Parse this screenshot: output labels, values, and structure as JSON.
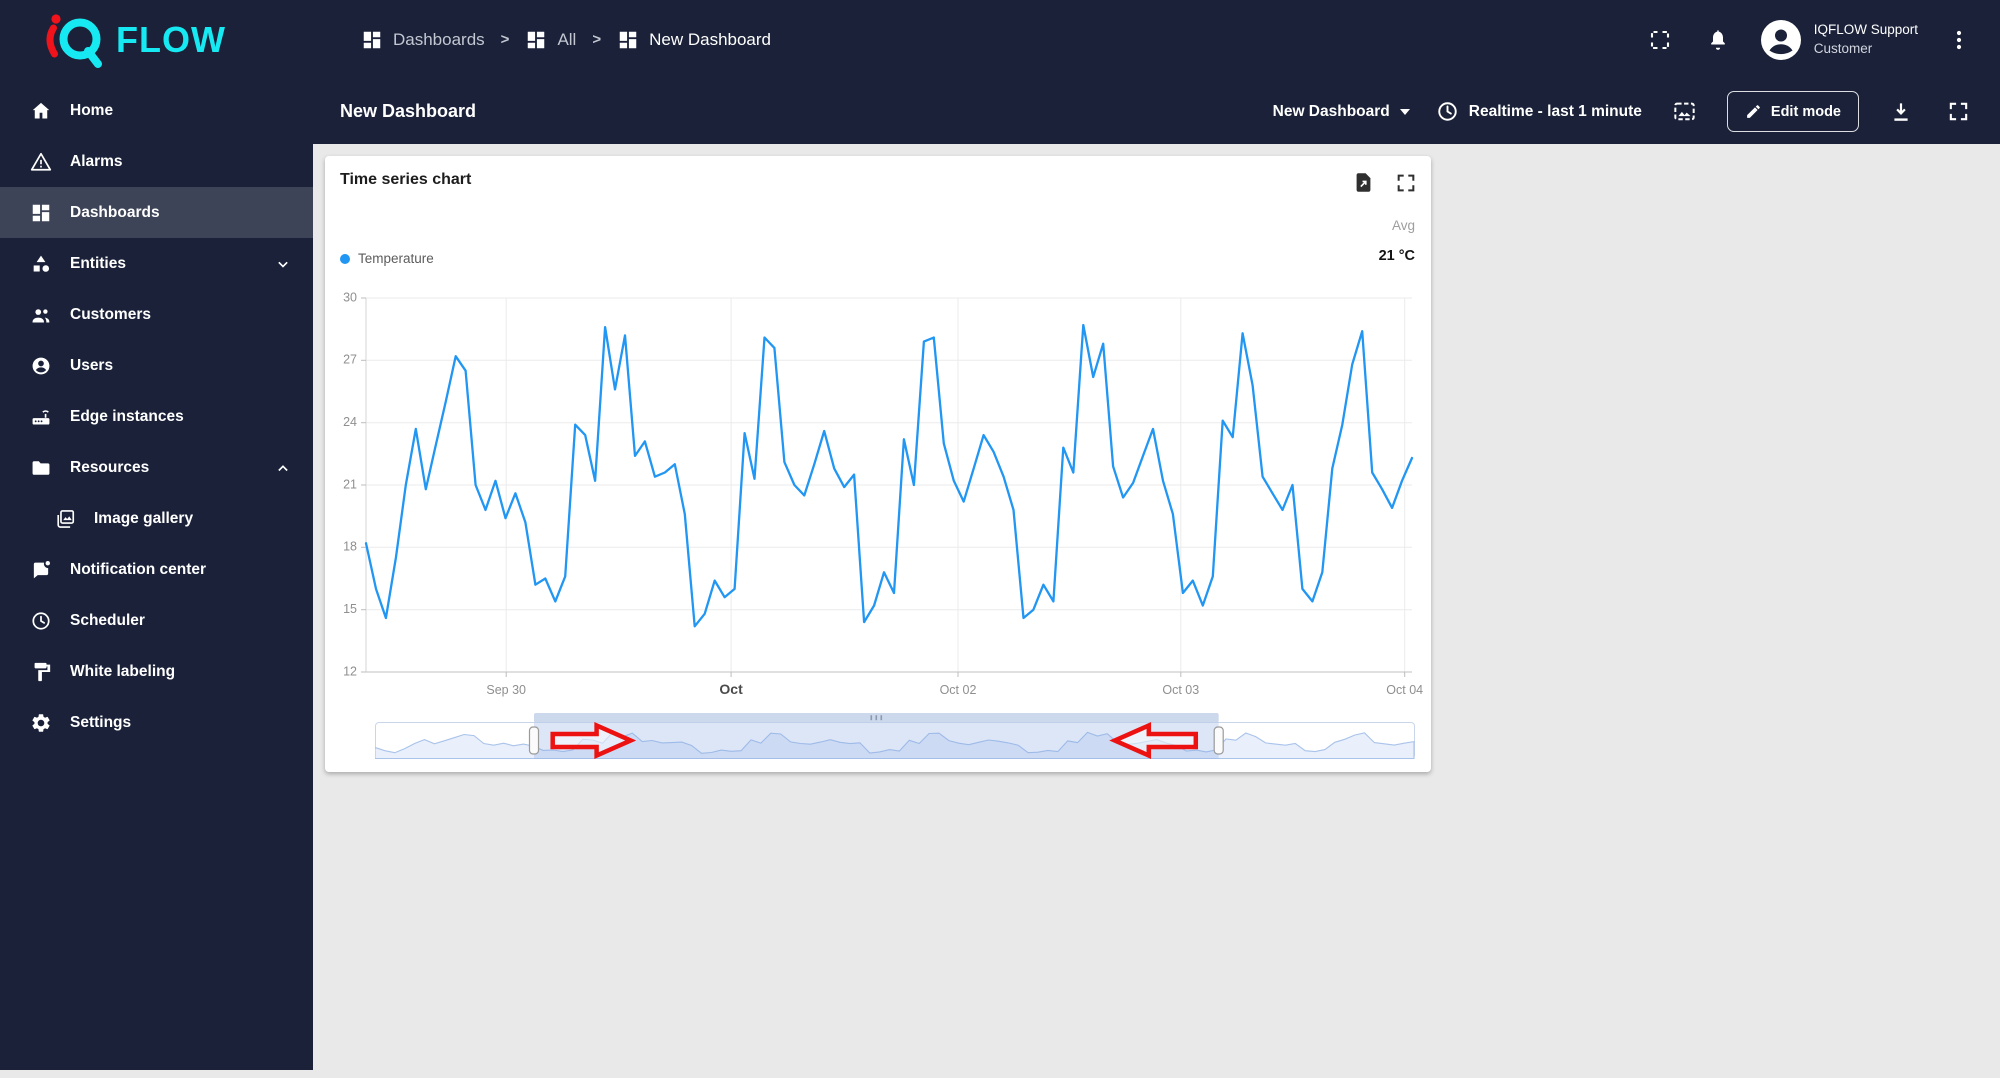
{
  "topbar": {
    "logo": {
      "flow_text": "FLOW",
      "accent_color": "#17e9f2",
      "dot_color": "#f0131b"
    },
    "breadcrumbs": [
      {
        "label": "Dashboards"
      },
      {
        "label": "All"
      },
      {
        "label": "New Dashboard"
      }
    ],
    "separator": ">",
    "user": {
      "name": "IQFLOW Support",
      "role": "Customer"
    }
  },
  "toolbar": {
    "title": "New Dashboard",
    "dashboard_select": "New Dashboard",
    "time_window": "Realtime - last 1 minute",
    "edit_button": "Edit mode"
  },
  "sidebar": {
    "items": [
      {
        "label": "Home",
        "icon": "home"
      },
      {
        "label": "Alarms",
        "icon": "alarms"
      },
      {
        "label": "Dashboards",
        "icon": "dashboards",
        "active": true
      },
      {
        "label": "Entities",
        "icon": "entities",
        "chevron": "down"
      },
      {
        "label": "Customers",
        "icon": "customers"
      },
      {
        "label": "Users",
        "icon": "users"
      },
      {
        "label": "Edge instances",
        "icon": "edge"
      },
      {
        "label": "Resources",
        "icon": "resources",
        "chevron": "up"
      },
      {
        "label": "Image gallery",
        "icon": "image-gallery",
        "child": true
      },
      {
        "label": "Notification center",
        "icon": "notification"
      },
      {
        "label": "Scheduler",
        "icon": "scheduler"
      },
      {
        "label": "White labeling",
        "icon": "white-labeling"
      },
      {
        "label": "Settings",
        "icon": "settings"
      }
    ]
  },
  "widget": {
    "title": "Time series chart",
    "legend_series": "Temperature",
    "agg_label": "Avg",
    "agg_value": "21 °C"
  },
  "chart_data": {
    "type": "line",
    "title": "Time series chart",
    "xlabel": "",
    "ylabel": "",
    "ylim": [
      12,
      30
    ],
    "yticks": [
      30,
      27,
      24,
      21,
      18,
      15,
      12
    ],
    "xticks": [
      {
        "frac": 0.134,
        "label": "Sep 30",
        "bold": false
      },
      {
        "frac": 0.349,
        "label": "Oct",
        "bold": true
      },
      {
        "frac": 0.566,
        "label": "Oct 02",
        "bold": false
      },
      {
        "frac": 0.779,
        "label": "Oct 03",
        "bold": false
      },
      {
        "frac": 0.993,
        "label": "Oct 04",
        "bold": false
      }
    ],
    "grid": true,
    "legend_position": "top-left",
    "series": [
      {
        "name": "Temperature",
        "color": "#2196f3",
        "avg": "21 °C",
        "values": [
          18.2,
          16.0,
          14.6,
          17.5,
          21.0,
          23.7,
          20.8,
          22.9,
          25.0,
          27.2,
          26.5,
          21.0,
          19.8,
          21.2,
          19.4,
          20.6,
          19.2,
          16.2,
          16.5,
          15.4,
          16.6,
          23.9,
          23.4,
          21.2,
          28.6,
          25.6,
          28.2,
          22.4,
          23.1,
          21.4,
          21.6,
          22.0,
          19.6,
          14.2,
          14.8,
          16.4,
          15.6,
          16.0,
          23.5,
          21.3,
          28.1,
          27.6,
          22.1,
          21.0,
          20.5,
          22.0,
          23.6,
          21.8,
          20.9,
          21.5,
          14.4,
          15.2,
          16.8,
          15.8,
          23.2,
          21.0,
          27.9,
          28.1,
          23.0,
          21.2,
          20.2,
          21.8,
          23.4,
          22.6,
          21.4,
          19.8,
          14.6,
          15.0,
          16.2,
          15.4,
          22.8,
          21.6,
          28.7,
          26.2,
          27.8,
          21.9,
          20.4,
          21.1,
          22.4,
          23.7,
          21.2,
          19.6,
          15.8,
          16.4,
          15.2,
          16.6,
          24.1,
          23.3,
          28.3,
          25.8,
          21.4,
          20.6,
          19.8,
          21.0,
          16.0,
          15.4,
          16.8,
          21.8,
          23.9,
          26.8,
          28.4,
          21.6,
          20.8,
          19.9,
          21.2,
          22.3
        ]
      }
    ],
    "navigator": {
      "selection_start": 0.153,
      "selection_end": 0.812
    },
    "annotation_arrows": [
      {
        "direction": "right",
        "start_frac": 0.171,
        "end_frac": 0.246
      },
      {
        "direction": "left",
        "start_frac": 0.712,
        "end_frac": 0.79
      }
    ],
    "arrow_color": "#ec1212"
  }
}
